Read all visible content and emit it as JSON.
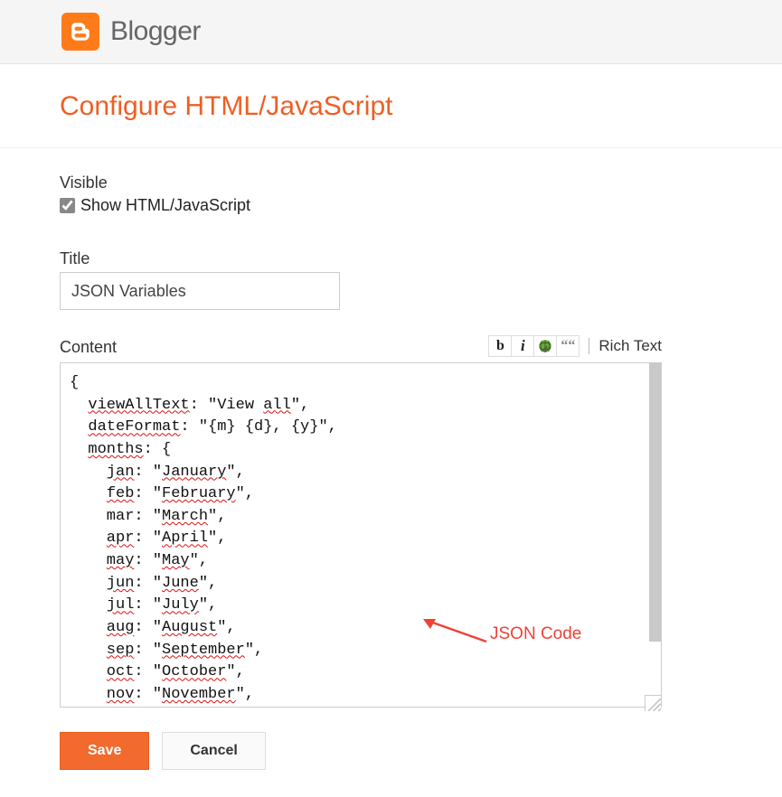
{
  "brand": "Blogger",
  "page_title": "Configure HTML/JavaScript",
  "visible": {
    "label": "Visible",
    "checkbox_label": "Show HTML/JavaScript",
    "checked": true
  },
  "title_field": {
    "label": "Title",
    "value": "JSON Variables"
  },
  "content": {
    "label": "Content",
    "toolbar": {
      "bold": "b",
      "italic": "i",
      "quote": "““",
      "rich_text": "Rich Text"
    },
    "text": "{\n  viewAllText: \"View all\",\n  dateFormat: \"{m} {d}, {y}\",\n  months: {\n    jan: \"January\",\n    feb: \"February\",\n    mar: \"March\",\n    apr: \"April\",\n    may: \"May\",\n    jun: \"June\",\n    jul: \"July\",\n    aug: \"August\",\n    sep: \"September\",\n    oct: \"October\",\n    nov: \"November\",\n    dec: \"December\""
  },
  "annotation": "JSON Code",
  "actions": {
    "save": "Save",
    "cancel": "Cancel"
  },
  "colors": {
    "accent": "#f26a2e",
    "heading": "#EE5F25",
    "annotation": "#ef4136"
  }
}
